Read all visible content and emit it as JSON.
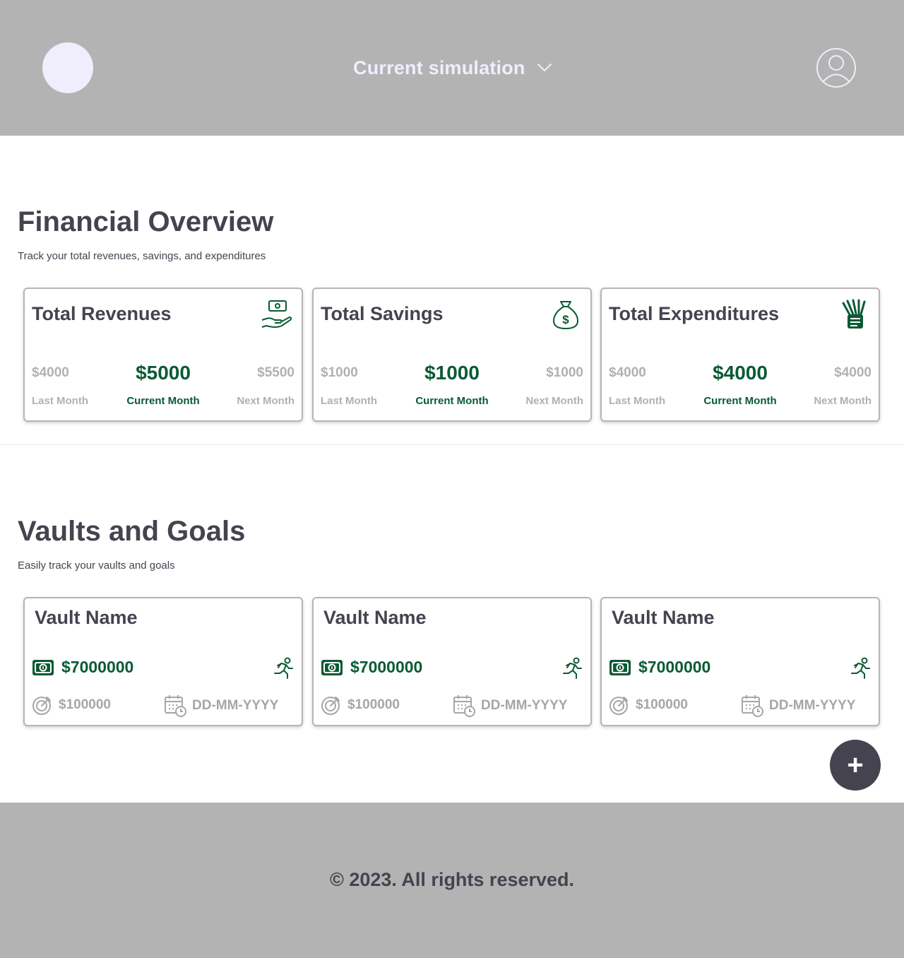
{
  "header": {
    "simulation_label": "Current simulation",
    "logo": "app-logo-circle",
    "profile_icon": "user-profile-icon"
  },
  "financial": {
    "title": "Financial Overview",
    "subtitle": "Track your total revenues, savings, and expenditures",
    "cards": [
      {
        "title": "Total Revenues",
        "icon": "cash-in-hand-icon",
        "last": "$4000",
        "current": "$5000",
        "next": "$5500",
        "last_label": "Last Month",
        "current_label": "Current Month",
        "next_label": "Next Month"
      },
      {
        "title": "Total Savings",
        "icon": "money-bag-icon",
        "last": "$1000",
        "current": "$1000",
        "next": "$1000",
        "last_label": "Last Month",
        "current_label": "Current Month",
        "next_label": "Next Month"
      },
      {
        "title": "Total Expenditures",
        "icon": "cash-stack-icon",
        "last": "$4000",
        "current": "$4000",
        "next": "$4000",
        "last_label": "Last Month",
        "current_label": "Current Month",
        "next_label": "Next Month"
      }
    ]
  },
  "vaults": {
    "title": "Vaults and Goals",
    "subtitle": "Easily track your vaults and goals",
    "items": [
      {
        "name": "Vault Name",
        "amount": "$7000000",
        "target": "$100000",
        "date": "DD-MM-YYYY"
      },
      {
        "name": "Vault Name",
        "amount": "$7000000",
        "target": "$100000",
        "date": "DD-MM-YYYY"
      },
      {
        "name": "Vault Name",
        "amount": "$7000000",
        "target": "$100000",
        "date": "DD-MM-YYYY"
      }
    ],
    "add_button": "+"
  },
  "footer": {
    "copyright": "© 2023. All rights reserved."
  },
  "colors": {
    "header_bg": "#b3b3b3",
    "accent_green": "#0a5a34",
    "text_dark": "#45434f",
    "muted": "#b1b1b1",
    "logo_fill": "#f0edfd"
  }
}
